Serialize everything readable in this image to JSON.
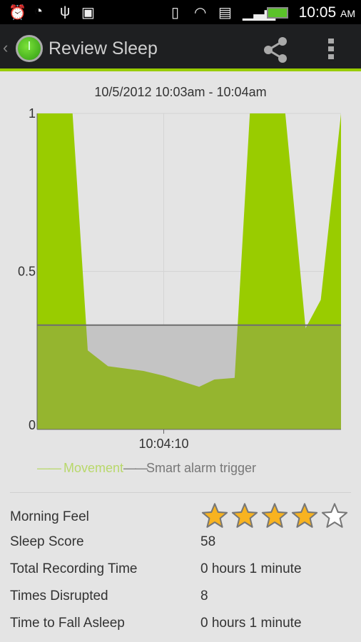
{
  "status_bar": {
    "time": "10:05",
    "ampm": "AM",
    "icons": [
      "alarm-icon",
      "speedometer-icon",
      "usb-icon",
      "android-debug-icon",
      "vibrate-icon",
      "wifi-icon",
      "sd-card-icon",
      "signal-icon",
      "battery-icon"
    ]
  },
  "action_bar": {
    "title": "Review Sleep",
    "share_icon": "share-icon",
    "menu_icon": "overflow-menu-icon"
  },
  "accent": "#99cc00",
  "chart_data": {
    "type": "area",
    "title": "10/5/2012 10:03am - 10:04am",
    "xlabel": "",
    "ylabel": "",
    "xticks": [
      "10:04:10"
    ],
    "yticks": [
      "0",
      "0.5",
      "1"
    ],
    "ylim": [
      0,
      1
    ],
    "xlim": [
      "10:03:45",
      "10:04:45"
    ],
    "grid": true,
    "legend_position": "bottom",
    "series": [
      {
        "name": "Movement",
        "color": "#99cc00",
        "x": [
          "10:03:45",
          "10:03:52",
          "10:03:55",
          "10:03:59",
          "10:04:06",
          "10:04:10",
          "10:04:17",
          "10:04:20",
          "10:04:24",
          "10:04:27",
          "10:04:34",
          "10:04:38",
          "10:04:41",
          "10:04:45"
        ],
        "values": [
          1,
          1,
          0.25,
          0.2,
          0.185,
          0.17,
          0.135,
          0.158,
          0.163,
          1,
          1,
          0.32,
          0.41,
          1
        ]
      },
      {
        "name": "Smart alarm trigger",
        "color": "#777777",
        "values": [
          0.33
        ]
      }
    ]
  },
  "stats": {
    "rows": [
      {
        "label": "Morning Feel"
      },
      {
        "label": "Sleep Score",
        "value": "58"
      },
      {
        "label": "Total Recording Time",
        "value": "0 hours 1 minute"
      },
      {
        "label": "Times Disrupted",
        "value": "8"
      },
      {
        "label": "Time to Fall Asleep",
        "value": "0 hours 1 minute"
      }
    ],
    "morning_feel_rating": 4,
    "morning_feel_max": 5,
    "star_color": "#f8b320"
  }
}
